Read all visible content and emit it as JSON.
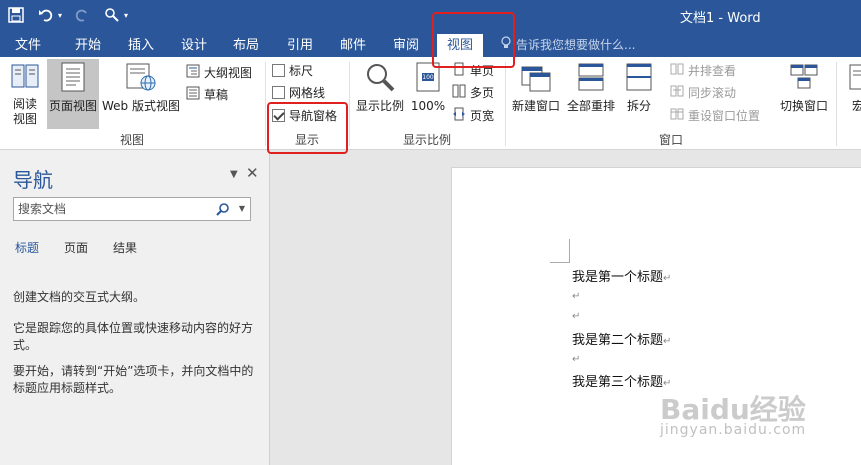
{
  "title_bar": {
    "document_title": "文档1 - Word"
  },
  "tabs": [
    {
      "label": "文件"
    },
    {
      "label": "开始"
    },
    {
      "label": "插入"
    },
    {
      "label": "设计"
    },
    {
      "label": "布局"
    },
    {
      "label": "引用"
    },
    {
      "label": "邮件"
    },
    {
      "label": "审阅"
    },
    {
      "label": "视图"
    }
  ],
  "tell_me": "告诉我您想要做什么...",
  "ribbon": {
    "views": {
      "label": "视图",
      "read_mode": "阅读\n视图",
      "print_layout": "页面视图",
      "web_layout": "Web 版式视图",
      "outline": "大纲视图",
      "draft": "草稿"
    },
    "show": {
      "label": "显示",
      "ruler": "标尺",
      "gridlines": "网格线",
      "nav_pane": "导航窗格",
      "ruler_checked": false,
      "gridlines_checked": false,
      "nav_pane_checked": true
    },
    "zoom": {
      "label": "显示比例",
      "zoom": "显示比例",
      "hundred": "100%",
      "one_page": "单页",
      "multi_page": "多页",
      "page_width": "页宽"
    },
    "window": {
      "label": "窗口",
      "new_window": "新建窗口",
      "arrange_all": "全部重排",
      "split": "拆分",
      "side_by_side": "并排查看",
      "sync_scroll": "同步滚动",
      "reset_position": "重设窗口位置",
      "switch_windows": "切换窗口"
    },
    "macros_partial": "宏"
  },
  "nav_pane": {
    "title": "导航",
    "search_placeholder": "搜索文档",
    "tabs": [
      {
        "label": "标题"
      },
      {
        "label": "页面"
      },
      {
        "label": "结果"
      }
    ],
    "text1": "创建文档的交互式大纲。",
    "text2": "它是跟踪您的具体位置或快速移动内容的好方式。",
    "text3": "要开始，请转到“开始”选项卡，并向文档中的标题应用标题样式。"
  },
  "document": {
    "lines": [
      "我是第一个标题",
      "",
      "",
      "我是第二个标题",
      "",
      "我是第三个标题"
    ],
    "pilcrow": "↵"
  },
  "watermark": {
    "brand": "Baidu经验",
    "url": "jingyan.baidu.com"
  },
  "colors": {
    "accent": "#2b579a",
    "highlight": "#e02020"
  }
}
